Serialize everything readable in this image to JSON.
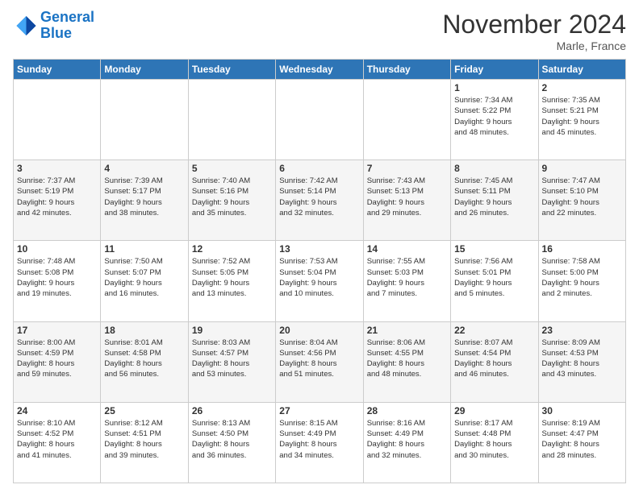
{
  "logo": {
    "line1": "General",
    "line2": "Blue"
  },
  "title": "November 2024",
  "location": "Marle, France",
  "weekdays": [
    "Sunday",
    "Monday",
    "Tuesday",
    "Wednesday",
    "Thursday",
    "Friday",
    "Saturday"
  ],
  "weeks": [
    [
      {
        "day": "",
        "info": ""
      },
      {
        "day": "",
        "info": ""
      },
      {
        "day": "",
        "info": ""
      },
      {
        "day": "",
        "info": ""
      },
      {
        "day": "",
        "info": ""
      },
      {
        "day": "1",
        "info": "Sunrise: 7:34 AM\nSunset: 5:22 PM\nDaylight: 9 hours\nand 48 minutes."
      },
      {
        "day": "2",
        "info": "Sunrise: 7:35 AM\nSunset: 5:21 PM\nDaylight: 9 hours\nand 45 minutes."
      }
    ],
    [
      {
        "day": "3",
        "info": "Sunrise: 7:37 AM\nSunset: 5:19 PM\nDaylight: 9 hours\nand 42 minutes."
      },
      {
        "day": "4",
        "info": "Sunrise: 7:39 AM\nSunset: 5:17 PM\nDaylight: 9 hours\nand 38 minutes."
      },
      {
        "day": "5",
        "info": "Sunrise: 7:40 AM\nSunset: 5:16 PM\nDaylight: 9 hours\nand 35 minutes."
      },
      {
        "day": "6",
        "info": "Sunrise: 7:42 AM\nSunset: 5:14 PM\nDaylight: 9 hours\nand 32 minutes."
      },
      {
        "day": "7",
        "info": "Sunrise: 7:43 AM\nSunset: 5:13 PM\nDaylight: 9 hours\nand 29 minutes."
      },
      {
        "day": "8",
        "info": "Sunrise: 7:45 AM\nSunset: 5:11 PM\nDaylight: 9 hours\nand 26 minutes."
      },
      {
        "day": "9",
        "info": "Sunrise: 7:47 AM\nSunset: 5:10 PM\nDaylight: 9 hours\nand 22 minutes."
      }
    ],
    [
      {
        "day": "10",
        "info": "Sunrise: 7:48 AM\nSunset: 5:08 PM\nDaylight: 9 hours\nand 19 minutes."
      },
      {
        "day": "11",
        "info": "Sunrise: 7:50 AM\nSunset: 5:07 PM\nDaylight: 9 hours\nand 16 minutes."
      },
      {
        "day": "12",
        "info": "Sunrise: 7:52 AM\nSunset: 5:05 PM\nDaylight: 9 hours\nand 13 minutes."
      },
      {
        "day": "13",
        "info": "Sunrise: 7:53 AM\nSunset: 5:04 PM\nDaylight: 9 hours\nand 10 minutes."
      },
      {
        "day": "14",
        "info": "Sunrise: 7:55 AM\nSunset: 5:03 PM\nDaylight: 9 hours\nand 7 minutes."
      },
      {
        "day": "15",
        "info": "Sunrise: 7:56 AM\nSunset: 5:01 PM\nDaylight: 9 hours\nand 5 minutes."
      },
      {
        "day": "16",
        "info": "Sunrise: 7:58 AM\nSunset: 5:00 PM\nDaylight: 9 hours\nand 2 minutes."
      }
    ],
    [
      {
        "day": "17",
        "info": "Sunrise: 8:00 AM\nSunset: 4:59 PM\nDaylight: 8 hours\nand 59 minutes."
      },
      {
        "day": "18",
        "info": "Sunrise: 8:01 AM\nSunset: 4:58 PM\nDaylight: 8 hours\nand 56 minutes."
      },
      {
        "day": "19",
        "info": "Sunrise: 8:03 AM\nSunset: 4:57 PM\nDaylight: 8 hours\nand 53 minutes."
      },
      {
        "day": "20",
        "info": "Sunrise: 8:04 AM\nSunset: 4:56 PM\nDaylight: 8 hours\nand 51 minutes."
      },
      {
        "day": "21",
        "info": "Sunrise: 8:06 AM\nSunset: 4:55 PM\nDaylight: 8 hours\nand 48 minutes."
      },
      {
        "day": "22",
        "info": "Sunrise: 8:07 AM\nSunset: 4:54 PM\nDaylight: 8 hours\nand 46 minutes."
      },
      {
        "day": "23",
        "info": "Sunrise: 8:09 AM\nSunset: 4:53 PM\nDaylight: 8 hours\nand 43 minutes."
      }
    ],
    [
      {
        "day": "24",
        "info": "Sunrise: 8:10 AM\nSunset: 4:52 PM\nDaylight: 8 hours\nand 41 minutes."
      },
      {
        "day": "25",
        "info": "Sunrise: 8:12 AM\nSunset: 4:51 PM\nDaylight: 8 hours\nand 39 minutes."
      },
      {
        "day": "26",
        "info": "Sunrise: 8:13 AM\nSunset: 4:50 PM\nDaylight: 8 hours\nand 36 minutes."
      },
      {
        "day": "27",
        "info": "Sunrise: 8:15 AM\nSunset: 4:49 PM\nDaylight: 8 hours\nand 34 minutes."
      },
      {
        "day": "28",
        "info": "Sunrise: 8:16 AM\nSunset: 4:49 PM\nDaylight: 8 hours\nand 32 minutes."
      },
      {
        "day": "29",
        "info": "Sunrise: 8:17 AM\nSunset: 4:48 PM\nDaylight: 8 hours\nand 30 minutes."
      },
      {
        "day": "30",
        "info": "Sunrise: 8:19 AM\nSunset: 4:47 PM\nDaylight: 8 hours\nand 28 minutes."
      }
    ]
  ]
}
